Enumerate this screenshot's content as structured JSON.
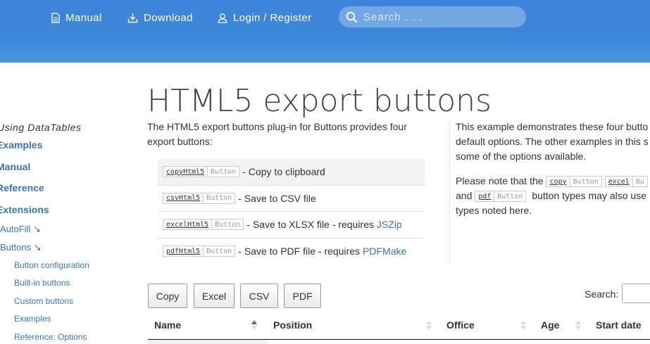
{
  "header": {
    "nav": [
      {
        "label": "Manual",
        "icon": "document-icon"
      },
      {
        "label": "Download",
        "icon": "download-icon"
      },
      {
        "label": "Login / Register",
        "icon": "user-icon"
      }
    ],
    "search_placeholder": "Search . . ."
  },
  "sidebar": {
    "heading": "Using DataTables",
    "items": [
      {
        "label": "Examples",
        "level": 1
      },
      {
        "label": "Manual",
        "level": 1
      },
      {
        "label": "Reference",
        "level": 1
      },
      {
        "label": "Extensions",
        "level": 1
      },
      {
        "label": "AutoFill ↘",
        "level": 2
      },
      {
        "label": "Buttons ↘",
        "level": 2
      },
      {
        "label": "Button configuration",
        "level": 3
      },
      {
        "label": "Built-in buttons",
        "level": 3
      },
      {
        "label": "Custom buttons",
        "level": 3
      },
      {
        "label": "Examples",
        "level": 3
      },
      {
        "label": "Reference: Options",
        "level": 3
      }
    ]
  },
  "main": {
    "title": "HTML5 export buttons",
    "intro": "The HTML5 export buttons plug-in for Buttons provides four export buttons:",
    "button_list": [
      {
        "code": "copyHtml5",
        "type": "Button",
        "text": "- Copy to clipboard",
        "link": ""
      },
      {
        "code": "csvHtml5",
        "type": "Button",
        "text": "- Save to CSV file",
        "link": ""
      },
      {
        "code": "excelHtml5",
        "type": "Button",
        "text": "- Save to XLSX file - requires",
        "link": "JSZip"
      },
      {
        "code": "pdfHtml5",
        "type": "Button",
        "text": "- Save to PDF file - requires",
        "link": "PDFMake"
      }
    ],
    "right": {
      "p1_l1": "This example demonstrates these four butto",
      "p1_l2": "default options. The other examples in this s",
      "p1_l3": "some of the options available.",
      "p2_pre": "Please note that the",
      "p2_and": "and",
      "p2_mid": "button types may also use",
      "p2_end": "types noted here.",
      "tags": [
        {
          "code": "copy",
          "type": "Button"
        },
        {
          "code": "excel",
          "type": "Bu"
        },
        {
          "code": "pdf",
          "type": "Button"
        }
      ]
    }
  },
  "datatable": {
    "buttons": [
      "Copy",
      "Excel",
      "CSV",
      "PDF"
    ],
    "search_label": "Search:",
    "columns": [
      "Name",
      "Position",
      "Office",
      "Age",
      "Start date"
    ]
  }
}
